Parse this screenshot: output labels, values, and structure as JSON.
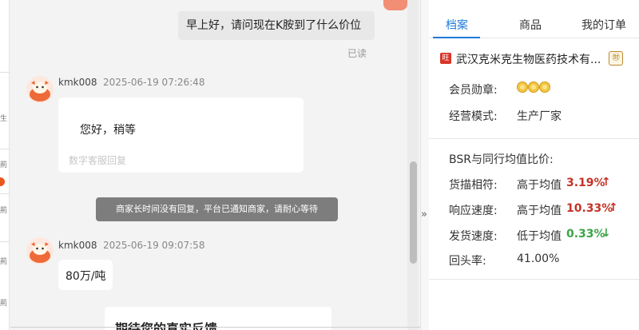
{
  "left_fragments": [
    "生",
    "荊",
    "荊",
    "荊",
    "荊"
  ],
  "chat": {
    "outgoing_message": "早上好，请问现在K胺到了什么价位",
    "read_status": "已读",
    "messages": [
      {
        "sender": "kmk008",
        "time": "2025-06-19 07:26:48",
        "text": "您好，稍等",
        "note": "数字客服回复"
      },
      {
        "sender": "kmk008",
        "time": "2025-06-19 09:07:58",
        "text": "80万/吨"
      }
    ],
    "system_notice": "商家长时间没有回复，平台已通知商家，请耐心等待",
    "cut_off_message": "期待您的真实反馈"
  },
  "collapse_glyph": "»",
  "panel": {
    "tabs": [
      {
        "label": "档案",
        "active": true
      },
      {
        "label": "商品",
        "active": false
      },
      {
        "label": "我的订单",
        "active": false
      }
    ],
    "shop": {
      "icon_label": "旺",
      "name": "武汉克米克生物医药技术有...",
      "badge": "㊖"
    },
    "info": [
      {
        "label": "会员勋章:",
        "medal_count": 3
      },
      {
        "label": "经营模式:",
        "value": "生产厂家"
      }
    ],
    "bsr_title": "BSR与同行均值比价:",
    "metrics": [
      {
        "label": "货描相符:",
        "comparison": "高于均值",
        "value": "3.19%",
        "arrow": "↑",
        "direction": "up"
      },
      {
        "label": "响应速度:",
        "comparison": "高于均值",
        "value": "10.33%",
        "arrow": "↑",
        "direction": "up"
      },
      {
        "label": "发货速度:",
        "comparison": "低于均值",
        "value": "0.33%",
        "arrow": "↓",
        "direction": "down"
      },
      {
        "label": "回头率:",
        "comparison": "41.00%"
      }
    ]
  },
  "colors": {
    "accent_blue": "#1f7bd8",
    "up_red": "#c53226",
    "down_green": "#3aa447",
    "brand_orange": "#e9571d"
  },
  "icons": [
    "avatar-icon",
    "shop-icon",
    "medal-icon",
    "badge-icon",
    "collapse-icon",
    "arrow-up-icon",
    "arrow-down-icon"
  ]
}
